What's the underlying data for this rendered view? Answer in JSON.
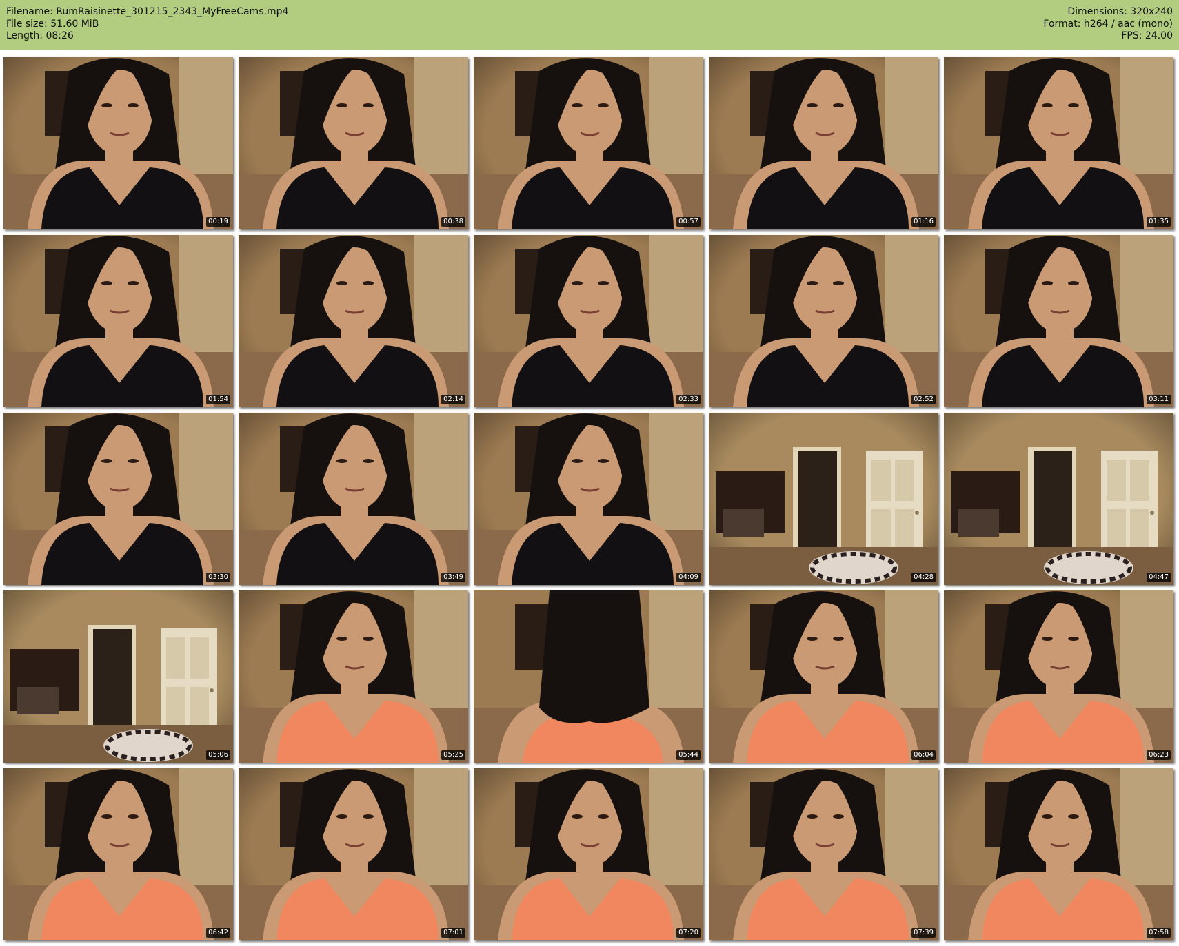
{
  "header": {
    "filename": "Filename: RumRaisinette_301215_2343_MyFreeCams.mp4",
    "filesize": "File size: 51.60 MiB",
    "length": "Length: 08:26",
    "dimensions": "Dimensions: 320x240",
    "format": "Format: h264 / aac (mono)",
    "fps": "FPS: 24.00"
  },
  "colors": {
    "header_bg": "#b2cc80",
    "top_black": "#121012",
    "top_orange": "#f0875e",
    "skin": "#c99a74",
    "hair": "#16110f",
    "room_wall": "#9c7b52",
    "door": "#e6dcc4"
  },
  "thumbnails": [
    {
      "time": "00:19",
      "scene": "face-black-top"
    },
    {
      "time": "00:38",
      "scene": "face-black-top"
    },
    {
      "time": "00:57",
      "scene": "face-black-top"
    },
    {
      "time": "01:16",
      "scene": "face-black-top"
    },
    {
      "time": "01:35",
      "scene": "face-black-top"
    },
    {
      "time": "01:54",
      "scene": "face-black-top"
    },
    {
      "time": "02:14",
      "scene": "face-black-top"
    },
    {
      "time": "02:33",
      "scene": "face-black-top"
    },
    {
      "time": "02:52",
      "scene": "face-black-top"
    },
    {
      "time": "03:11",
      "scene": "face-black-top"
    },
    {
      "time": "03:30",
      "scene": "face-black-top"
    },
    {
      "time": "03:49",
      "scene": "face-black-top"
    },
    {
      "time": "04:09",
      "scene": "face-black-top"
    },
    {
      "time": "04:28",
      "scene": "empty-room"
    },
    {
      "time": "04:47",
      "scene": "empty-room"
    },
    {
      "time": "05:06",
      "scene": "empty-room"
    },
    {
      "time": "05:25",
      "scene": "face-orange-top"
    },
    {
      "time": "05:44",
      "scene": "hair-orange-top"
    },
    {
      "time": "06:04",
      "scene": "face-orange-top"
    },
    {
      "time": "06:23",
      "scene": "face-orange-top"
    },
    {
      "time": "06:42",
      "scene": "face-orange-top"
    },
    {
      "time": "07:01",
      "scene": "face-orange-top"
    },
    {
      "time": "07:20",
      "scene": "face-orange-top"
    },
    {
      "time": "07:39",
      "scene": "face-orange-top"
    },
    {
      "time": "07:58",
      "scene": "face-orange-top"
    }
  ]
}
